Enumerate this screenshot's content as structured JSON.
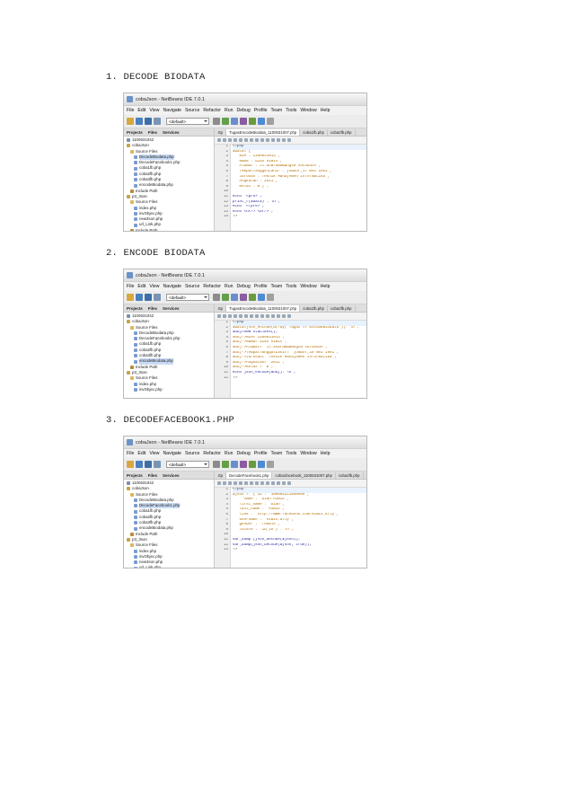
{
  "sections": [
    {
      "heading": "1. DECODE BIODATA",
      "window_title": "cobaJson - NetBeans IDE 7.0.1",
      "menu": [
        "File",
        "Edit",
        "View",
        "Navigate",
        "Source",
        "Refactor",
        "Run",
        "Debug",
        "Profile",
        "Team",
        "Tools",
        "Window",
        "Help"
      ],
      "config_value": "<default>",
      "panel_tabs": [
        "Projects",
        "Files",
        "Services"
      ],
      "tree": [
        "1100631042",
        "cobaJson",
        "Source Files",
        "DecodeBiodata.php",
        "DecodeFacebook1.php",
        "coba1fb.php",
        "coba2fb.php",
        "coba3fb.php",
        "encodeBiodata.php",
        "Include Path",
        "p3_3son",
        "Source Files",
        "index.php",
        "invObjec.php",
        "new3son.php",
        "url_Link.php",
        "Include Path",
        "Perusahaan"
      ],
      "selected_index": 3,
      "editor_tabs": [
        ".ttp",
        "TugasEncodeBiodata_1100631007.php",
        "coba1fb.php",
        "coba2fb.php"
      ],
      "active_tab": 1,
      "lines": [
        "1",
        "2",
        "3",
        "4",
        "5",
        "6",
        "7",
        "8",
        "9",
        "10",
        "11",
        "12",
        "13",
        "14",
        "15"
      ],
      "code": [
        "<?php",
        "$data='{",
        "  \"NIM\":\"1100631013\",",
        "  \"Nama\":\"dian eimis\",",
        "  \"Alamat\":\"Jl.Sharamawangsa sutubuoh\",",
        "  \"TempatTanggalLahir\":\"jombor,17 mei 1991\",",
        "  \"Jurusan\":\"Teknik Manajemen Informatika\",",
        "  \"Angkatan\":\"2011\",",
        "  \"Kelas\":\"B\"}';",
        "",
        "echo \"<pre>\";",
        "print_r($data) .\"\\n\";",
        "echo \"</pre>\";",
        "echo\"<hr/> <br/>\";",
        "?>"
      ]
    },
    {
      "heading": "2. ENCODE BIODATA",
      "window_title": "cobaJson - NetBeans IDE 7.0.1",
      "menu": [
        "File",
        "Edit",
        "View",
        "Navigate",
        "Source",
        "Refactor",
        "Run",
        "Debug",
        "Profile",
        "Team",
        "Tools",
        "Window",
        "Help"
      ],
      "config_value": "<default>",
      "panel_tabs": [
        "Projects",
        "Files",
        "Services"
      ],
      "tree": [
        "1100631042",
        "cobaJson",
        "Source Files",
        "DecodeBiodata.php",
        "DecodeFacebook1.php",
        "coba1fb.php",
        "coba2fb.php",
        "coba3fb.php",
        "encodeBiodata.php",
        "Include Path",
        "p3_3son",
        "Source Files",
        "index.php",
        "invObjec.php"
      ],
      "selected_index": 8,
      "editor_tabs": [
        ".ttp",
        "TugasEncodeBiodata_1100631007.php",
        "coba1fb.php",
        "coba2fb.php"
      ],
      "active_tab": 1,
      "lines": [
        "1",
        "2",
        "3",
        "4",
        "5",
        "6",
        "7",
        "8",
        "9",
        "10",
        "11",
        "12"
      ],
      "code": [
        "<?php",
        "$data=json_encode(array(\"Tugas\"=>\"EncodeBiodata\")).\"\\n\";",
        "$obj=new stdClass();",
        "$obj->NIM=\"1100631013\";",
        "$obj->Nama=\"dian eimis\";",
        "$obj->Alamat= \"Jl.Sharamawangsa sutubuoh\";",
        "$obj->TempatTanggalLahir= \"jombor,10 mei 1991\";",
        "$obj->Jurusan= \"Teknik Manajemen Informatika\";",
        "$obj->Angkatan= \"2011\";",
        "$obj->Kelas = \"B\";",
        "echo json_encode($obj).\"\\n\";",
        "?>"
      ]
    },
    {
      "heading": "3. DECODEFACEBOOK1.PHP",
      "window_title": "cobaJson - NetBeans IDE 7.0.1",
      "menu": [
        "File",
        "Edit",
        "View",
        "Navigate",
        "Source",
        "Refactor",
        "Run",
        "Debug",
        "Profile",
        "Team",
        "Tools",
        "Window",
        "Help"
      ],
      "config_value": "<default>",
      "panel_tabs": [
        "Projects",
        "Files",
        "Services"
      ],
      "tree": [
        "1100631042",
        "cobaJson",
        "Source Files",
        "DecodeBiodata.php",
        "DecodeFacebook1.php",
        "coba1fb.php",
        "coba2fb.php",
        "coba3fb.php",
        "encodeBiodata.php",
        "Include Path",
        "p3_3son",
        "Source Files",
        "index.php",
        "invObjec.php",
        "new3son.php",
        "url_Link.php",
        "Include Path"
      ],
      "selected_index": 4,
      "editor_tabs": [
        ".ttp",
        "DecodeFacebook1.php",
        "coba1facebook_1100631007.php",
        "coba2fb.php"
      ],
      "active_tab": 1,
      "lines": [
        "1",
        "2",
        "3",
        "4",
        "5",
        "6",
        "7",
        "8",
        "9",
        "10",
        "11",
        "12",
        "13"
      ],
      "code": [
        "<?php",
        "$json = '{\"id\": \"100004211050966\",",
        "    \"name\": \"Dian eimis\",",
        "  \"first_name\": \"Dian\",",
        "  \"last_name\": \"eimis\",",
        "  \"link\": \"http://www.facebook.com/eimis.ally\",",
        "  \"username\": \"eimis.ally\",",
        "  \"gender\": \"female\",",
        "  \"locale\": \"id_ID\"}'.\"\\n\";",
        "",
        "var_dump (json_decode($json));",
        "var_dump(json_decode($json, true));",
        "?>"
      ]
    }
  ]
}
